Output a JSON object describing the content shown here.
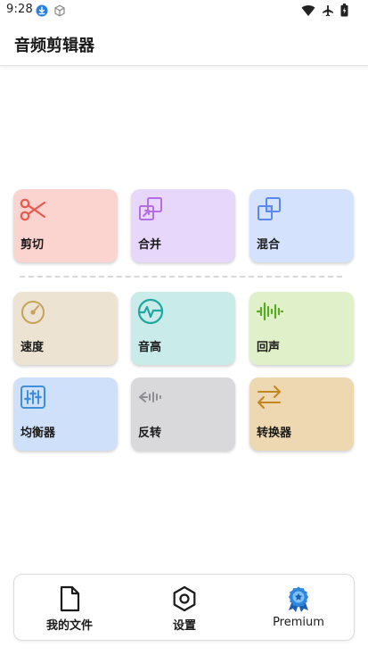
{
  "status_bar": {
    "time": "9:28",
    "left_icons": [
      "download-icon",
      "cube-icon"
    ],
    "right_icons": [
      "wifi-icon",
      "airplane-icon",
      "battery-icon"
    ]
  },
  "app_bar": {
    "title": "音频剪辑器"
  },
  "tools": [
    {
      "label": "剪切",
      "icon": "scissors-icon",
      "bg": "#fbd3cf",
      "accent": "#e85a4f"
    },
    {
      "label": "合并",
      "icon": "merge-icon",
      "bg": "#e6d7fb",
      "accent": "#b56de4"
    },
    {
      "label": "混合",
      "icon": "mix-icon",
      "bg": "#d4e2fd",
      "accent": "#5a88ec"
    },
    {
      "label": "速度",
      "icon": "speedometer-icon",
      "bg": "#ede3d3",
      "accent": "#c6a25a"
    },
    {
      "label": "音高",
      "icon": "pitch-icon",
      "bg": "#c9ebe9",
      "accent": "#1fa7a0"
    },
    {
      "label": "回声",
      "icon": "echo-icon",
      "bg": "#e0f0c9",
      "accent": "#59a826"
    },
    {
      "label": "均衡器",
      "icon": "equalizer-icon",
      "bg": "#cfe1fa",
      "accent": "#3f8ed8"
    },
    {
      "label": "反转",
      "icon": "reverse-icon",
      "bg": "#d9d9dc",
      "accent": "#8d8d93"
    },
    {
      "label": "转换器",
      "icon": "convert-icon",
      "bg": "#edd8b2",
      "accent": "#c2861d"
    }
  ],
  "bottom_nav": [
    {
      "label": "我的文件",
      "icon": "file-icon"
    },
    {
      "label": "设置",
      "icon": "settings-icon"
    },
    {
      "label": "Premium",
      "icon": "premium-badge-icon"
    }
  ],
  "colors": {
    "premium_accent": "#2f86e0",
    "nav_icon": "#1a1a1a"
  }
}
